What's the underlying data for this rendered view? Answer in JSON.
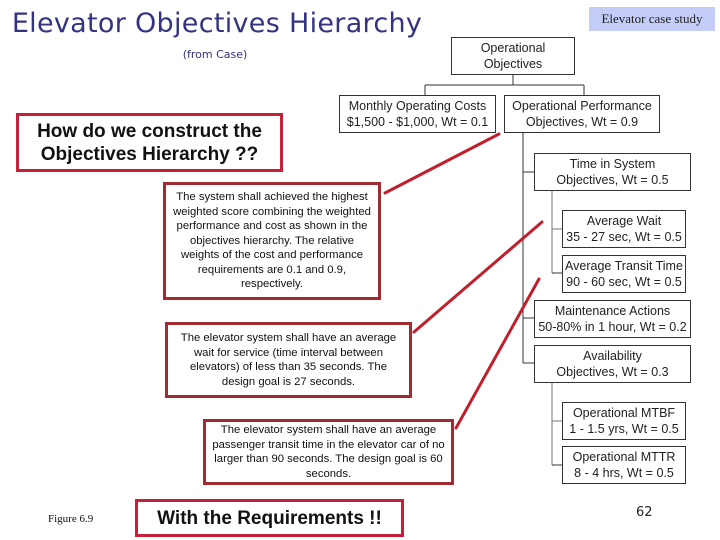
{
  "header": {
    "title": "Elevator Objectives Hierarchy",
    "subtitle": "(from Case)",
    "badge": "Elevator case study"
  },
  "hierarchy": {
    "root": {
      "line1": "Operational",
      "line2": "Objectives"
    },
    "cost": {
      "line1": "Monthly Operating Costs",
      "line2": "$1,500 - $1,000, Wt = 0.1",
      "weight": 0.1
    },
    "performance": {
      "line1": "Operational Performance",
      "line2": "Objectives, Wt = 0.9",
      "weight": 0.9
    },
    "time_in_system": {
      "line1": "Time in System",
      "line2": "Objectives, Wt = 0.5",
      "weight": 0.5
    },
    "average_wait": {
      "line1": "Average Wait",
      "line2": "35 - 27 sec, Wt = 0.5",
      "weight": 0.5
    },
    "average_transit": {
      "line1": "Average Transit Time",
      "line2": "90 - 60 sec, Wt = 0.5",
      "weight": 0.5
    },
    "maintenance": {
      "line1": "Maintenance Actions",
      "line2": "50-80% in 1 hour, Wt = 0.2",
      "weight": 0.2
    },
    "availability": {
      "line1": "Availability",
      "line2": "Objectives, Wt = 0.3",
      "weight": 0.3
    },
    "mtbf": {
      "line1": "Operational MTBF",
      "line2": "1 - 1.5 yrs, Wt = 0.5",
      "weight": 0.5
    },
    "mttr": {
      "line1": "Operational MTTR",
      "line2": "8 - 4 hrs, Wt = 0.5",
      "weight": 0.5
    }
  },
  "callouts": {
    "question": {
      "line1": "How do we construct the",
      "line2": "Objectives Hierarchy ??"
    },
    "weights": "The system shall achieved the highest weighted score combining the weighted performance and cost as shown in the objectives hierarchy. The relative weights of the cost and performance requirements are 0.1 and 0.9, respectively.",
    "wait": "The elevator system shall have an average wait for service (time interval between elevators) of less than 35 seconds.  The design goal is 27 seconds.",
    "transit": "The elevator system shall have an average passenger transit time in the elevator car of no larger than 90 seconds.  The design goal is 60 seconds.",
    "answer": "With the Requirements !!"
  },
  "footer": {
    "figure": "Figure 6.9",
    "page": "62"
  },
  "colors": {
    "title": "#333380",
    "badge_bg": "#c3cdf7",
    "callout_border": "#a32a33",
    "connector_red": "#c0202b",
    "tree_line": "#333333"
  }
}
